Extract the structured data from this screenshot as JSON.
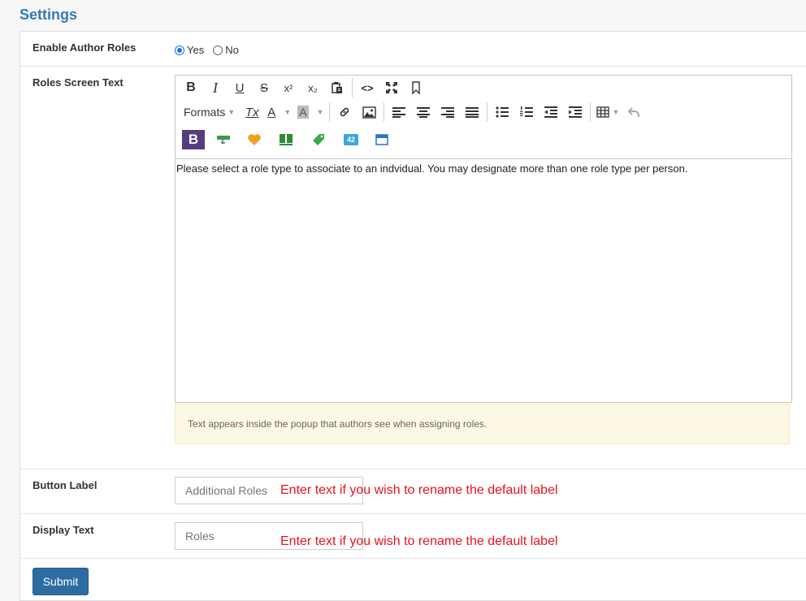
{
  "page": {
    "title": "Settings"
  },
  "enable_roles": {
    "label": "Enable Author Roles",
    "options": [
      "Yes",
      "No"
    ],
    "selected": "Yes"
  },
  "roles_text": {
    "label": "Roles Screen Text",
    "toolbar": {
      "row1": [
        "bold-icon",
        "italic-icon",
        "underline-icon",
        "strikethrough-icon",
        "superscript-icon",
        "subscript-icon",
        "paste-icon",
        "code-icon",
        "fullscreen-icon",
        "bookmark-icon"
      ],
      "formats_label": "Formats",
      "row2": [
        "clear-format-icon",
        "text-color-icon",
        "background-color-icon",
        "link-icon",
        "image-icon",
        "align-left-icon",
        "align-center-icon",
        "align-right-icon",
        "justify-icon",
        "bullet-list-icon",
        "numbered-list-icon",
        "outdent-icon",
        "indent-icon",
        "table-icon",
        "undo-icon"
      ],
      "row3": [
        "bootstrap-icon",
        "component-icon",
        "heart-icon",
        "layout-icon",
        "tag-icon",
        "counter-icon",
        "window-icon"
      ],
      "counter_label": "42",
      "bootstrap_label": "B",
      "sup_glyph": "x²",
      "sub_glyph": "x₂",
      "code_glyph": "<>",
      "text_color_glyph": "A",
      "bg_color_glyph": "A",
      "italic_glyph": "I",
      "bold_glyph": "B",
      "underline_glyph": "U",
      "strike_glyph": "S",
      "clear_glyph": "Tx"
    },
    "content": "Please select a role type to associate to an indvidual. You may designate more than one role type per person.",
    "help": "Text appears inside the popup that authors see when assigning roles."
  },
  "button_label": {
    "label": "Button Label",
    "placeholder": "Additional Roles",
    "hint": "Enter text if you wish to rename the default label"
  },
  "display_text": {
    "label": "Display Text",
    "placeholder": "Roles",
    "hint": "Enter text if you wish to rename the default label"
  },
  "submit": {
    "label": "Submit"
  },
  "colors": {
    "accent": "#337ab7",
    "button": "#2d6ca2",
    "hint": "#e8141b",
    "help_bg": "#fcf8e3"
  }
}
